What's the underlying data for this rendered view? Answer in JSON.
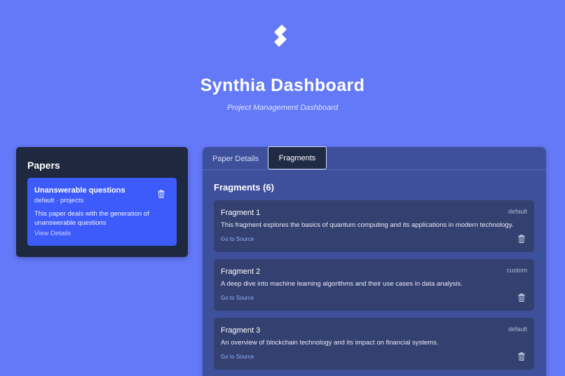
{
  "header": {
    "title": "Synthia Dashboard",
    "subtitle": "Project Management Dashboard",
    "logo_icon": "synthia-s-logo"
  },
  "papers": {
    "heading": "Papers",
    "items": [
      {
        "name": "Unanswerable questions",
        "meta": "default · projects",
        "description": "This paper deals with the generation of unanswerable questions",
        "link_label": "View Details",
        "icon": "trash-icon"
      }
    ]
  },
  "tabs": [
    {
      "label": "Paper Details",
      "active": false
    },
    {
      "label": "Fragments",
      "active": true
    }
  ],
  "fragments": {
    "heading": "Fragments (6)",
    "items": [
      {
        "title": "Fragment 1",
        "tag": "default",
        "description": "This fragment explores the basics of quantum computing and its applications in modern technology.",
        "link_label": "Go to Source"
      },
      {
        "title": "Fragment 2",
        "tag": "custom",
        "description": "A deep dive into machine learning algorithms and their use cases in data analysis.",
        "link_label": "Go to Source"
      },
      {
        "title": "Fragment 3",
        "tag": "default",
        "description": "An overview of blockchain technology and its impact on financial systems.",
        "link_label": "Go to Source"
      }
    ]
  },
  "colors": {
    "background": "#6479f8",
    "papers_panel": "#1e283f",
    "paper_card": "#3d5bfa",
    "main_panel": "#3e4f9b",
    "fragment_card": "#34406f",
    "link": "#8fb2ff"
  }
}
